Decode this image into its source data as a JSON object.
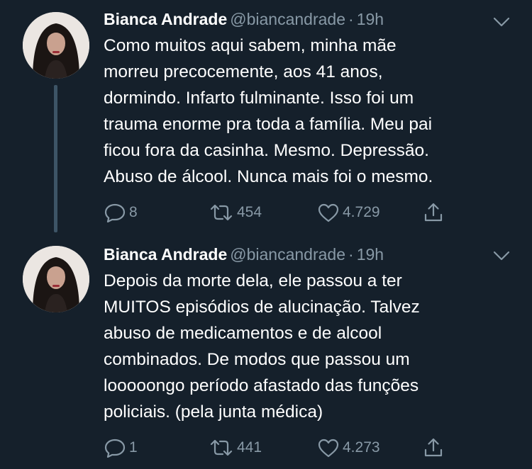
{
  "tweets": [
    {
      "author": {
        "name": "Bianca Andrade",
        "handle": "@biancandrade"
      },
      "separator": "·",
      "time": "19h",
      "text_lines": [
        "Como muitos aqui sabem, minha mãe",
        "morreu precocemente, aos 41 anos,",
        "dormindo. Infarto fulminante. Isso foi um",
        "trauma enorme pra toda a família. Meu pai",
        "ficou fora da casinha. Mesmo. Depressão.",
        "Abuso de álcool. Nunca mais foi o mesmo."
      ],
      "stats": {
        "replies": "8",
        "retweets": "454",
        "likes": "4.729"
      }
    },
    {
      "author": {
        "name": "Bianca Andrade",
        "handle": "@biancandrade"
      },
      "separator": "·",
      "time": "19h",
      "text_lines": [
        "Depois da morte dela, ele passou a ter",
        "MUITOS episódios de alucinação. Talvez",
        "abuso de medicamentos e de alcool",
        "combinados. De modos que passou um",
        "looooongo período afastado  das funções",
        "policiais. (pela junta médica)"
      ],
      "stats": {
        "replies": "1",
        "retweets": "441",
        "likes": "4.273"
      }
    }
  ],
  "icons": {
    "reply": "reply-icon",
    "retweet": "retweet-icon",
    "like": "heart-icon",
    "share": "share-icon",
    "more": "chevron-down-icon"
  },
  "colors": {
    "background": "#15202b",
    "text_primary": "#ffffff",
    "text_secondary": "#8899a6",
    "thread_line": "#3d5466"
  }
}
